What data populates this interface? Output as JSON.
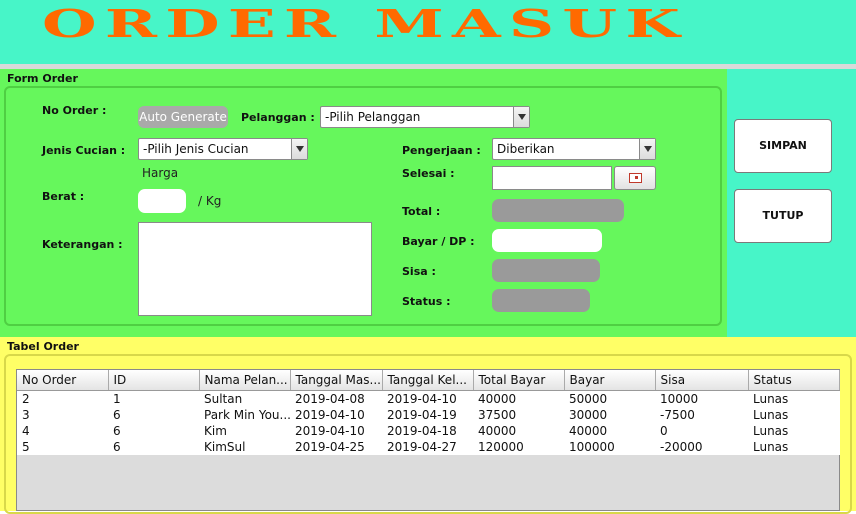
{
  "header": {
    "title": "ORDER MASUK"
  },
  "form": {
    "section_label": "Form Order",
    "no_order_label": "No Order :",
    "no_order_value": "Auto Generate",
    "pelanggan_label": "Pelanggan :",
    "pelanggan_value": "-Pilih Pelanggan",
    "jenis_cucian_label": "Jenis Cucian :",
    "jenis_cucian_value": "-Pilih Jenis Cucian",
    "harga_label": "Harga",
    "berat_label": "Berat :",
    "berat_unit": "/ Kg",
    "keterangan_label": "Keterangan :",
    "pengerjaan_label": "Pengerjaan :",
    "pengerjaan_value": "Diberikan",
    "selesai_label": "Selesai :",
    "total_label": "Total :",
    "bayar_label": "Bayar / DP :",
    "sisa_label": "Sisa :",
    "status_label": "Status :"
  },
  "buttons": {
    "simpan": "SIMPAN",
    "tutup": "TUTUP"
  },
  "icons": {
    "date_picker": "calendar-icon",
    "dropdown": "chevron-down-icon"
  },
  "colors": {
    "header_bg": "#47f5c8",
    "title": "#ff6a00",
    "form_bg": "#66f75c",
    "table_section_bg": "#ffff66"
  },
  "table": {
    "section_label": "Tabel Order",
    "columns": [
      "No Order",
      "ID",
      "Nama Pelan...",
      "Tanggal Mas...",
      "Tanggal Kel...",
      "Total Bayar",
      "Bayar",
      "Sisa",
      "Status"
    ],
    "rows": [
      [
        "2",
        "1",
        "Sultan",
        "2019-04-08",
        "2019-04-10",
        "40000",
        "50000",
        "10000",
        "Lunas"
      ],
      [
        "3",
        "6",
        "Park Min You...",
        "2019-04-10",
        "2019-04-19",
        "37500",
        "30000",
        "-7500",
        "Lunas"
      ],
      [
        "4",
        "6",
        "Kim",
        "2019-04-10",
        "2019-04-18",
        "40000",
        "40000",
        "0",
        "Lunas"
      ],
      [
        "5",
        "6",
        "KimSul",
        "2019-04-25",
        "2019-04-27",
        "120000",
        "100000",
        "-20000",
        "Lunas"
      ]
    ]
  }
}
